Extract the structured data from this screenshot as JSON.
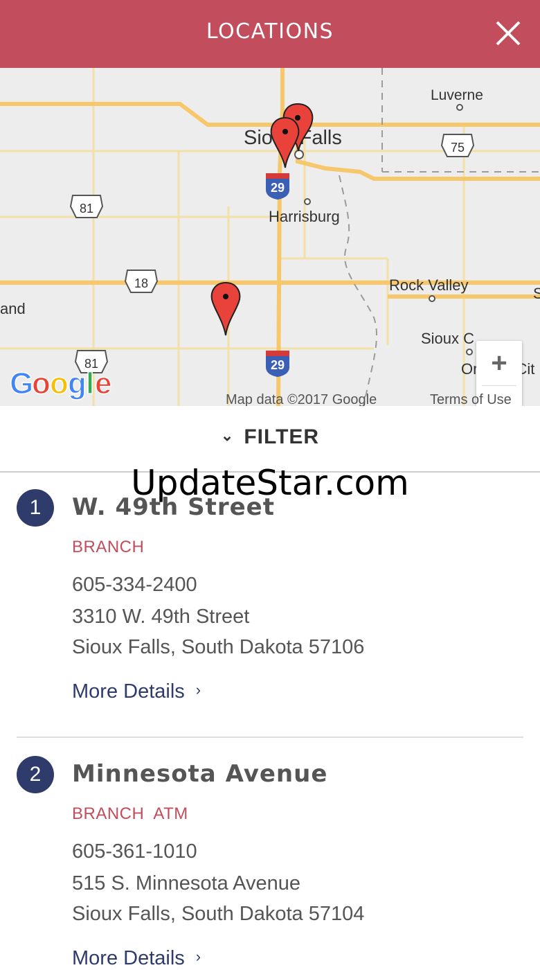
{
  "header": {
    "title": "LOCATIONS",
    "close_icon": "close-icon"
  },
  "map": {
    "labels": {
      "luverne": "Luverne",
      "sioux_falls": "Sioux Falls",
      "harrisburg": "Harrisburg",
      "rock_valley": "Rock Valley",
      "sioux_center": "Sioux C",
      "orange_city": "Orange Cit",
      "land": "and",
      "edge_s": "S"
    },
    "shields": {
      "i29": "29",
      "us81": "81",
      "us18": "18",
      "us75": "75"
    },
    "logo": "Google",
    "credits": "Map data ©2017 Google",
    "terms": "Terms of Use",
    "zoom_in": "+",
    "zoom_out": "−"
  },
  "filter": {
    "label": "FILTER",
    "chevron": "⌄"
  },
  "watermark": "UpdateStar.com",
  "locations": [
    {
      "number": "1",
      "name": "W. 49th Street",
      "type": "BRANCH",
      "phone": "605-334-2400",
      "address1": "3310 W. 49th Street",
      "address2": "Sioux Falls, South Dakota 57106",
      "more": "More Details",
      "chevron": "›"
    },
    {
      "number": "2",
      "name": "Minnesota Avenue",
      "type": "BRANCH  ATM",
      "phone": "605-361-1010",
      "address1": "515 S. Minnesota Avenue",
      "address2": "Sioux Falls, South Dakota 57104",
      "more": "More Details",
      "chevron": "›"
    }
  ],
  "colors": {
    "accent": "#c24d5c",
    "navy": "#2f3c6b",
    "road": "#f6c76b",
    "pin": "#e9423a"
  }
}
